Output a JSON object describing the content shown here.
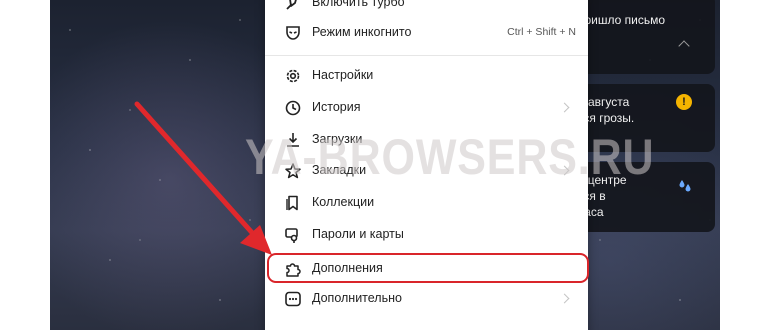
{
  "cards": {
    "mail": {
      "text": "пришло письмо"
    },
    "weather": {
      "lines": [
        "4 августа",
        "тся грозы."
      ],
      "icon": "warning-icon"
    },
    "news": {
      "lines": [
        "в центре",
        "тся в",
        "часа"
      ],
      "icon": "raindrops-icon"
    }
  },
  "menu": {
    "items": [
      {
        "name": "turbo",
        "label": "Включить турбо",
        "icon": "rocket-icon"
      },
      {
        "name": "incognito",
        "label": "Режим инкогнито",
        "icon": "incognito-mask-icon",
        "shortcut": "Ctrl + Shift + N"
      },
      {
        "name": "settings",
        "label": "Настройки",
        "icon": "gear-icon"
      },
      {
        "name": "history",
        "label": "История",
        "icon": "clock-icon",
        "submenu": true
      },
      {
        "name": "downloads",
        "label": "Загрузки",
        "icon": "download-icon"
      },
      {
        "name": "bookmarks",
        "label": "Закладки",
        "icon": "star-icon",
        "submenu": true
      },
      {
        "name": "collections",
        "label": "Коллекции",
        "icon": "bookmark-icon"
      },
      {
        "name": "passwords",
        "label": "Пароли и карты",
        "icon": "key-card-icon"
      },
      {
        "name": "extensions",
        "label": "Дополнения",
        "icon": "puzzle-icon",
        "highlighted": true
      },
      {
        "name": "more",
        "label": "Дополнительно",
        "icon": "more-dots-icon",
        "submenu": true
      }
    ]
  },
  "annotation": {
    "watermark": "YA-BROWSERS.RU",
    "arrow_color": "#e0282c",
    "highlight_color": "#d9252a"
  }
}
